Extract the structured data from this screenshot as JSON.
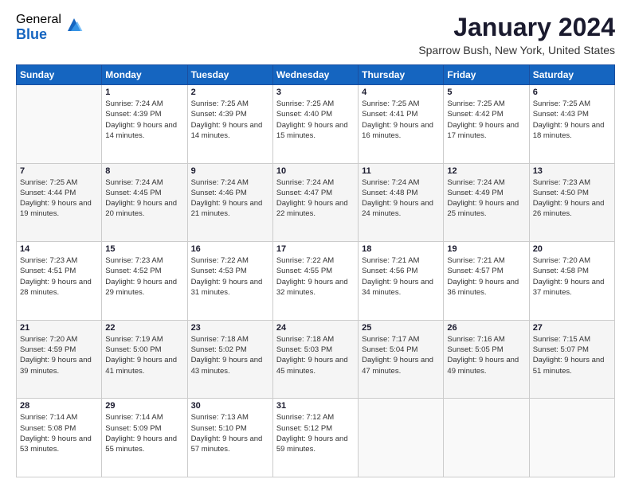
{
  "logo": {
    "general": "General",
    "blue": "Blue"
  },
  "title": "January 2024",
  "location": "Sparrow Bush, New York, United States",
  "days_of_week": [
    "Sunday",
    "Monday",
    "Tuesday",
    "Wednesday",
    "Thursday",
    "Friday",
    "Saturday"
  ],
  "weeks": [
    [
      {
        "day": "",
        "sunrise": "",
        "sunset": "",
        "daylight": ""
      },
      {
        "day": "1",
        "sunrise": "Sunrise: 7:24 AM",
        "sunset": "Sunset: 4:39 PM",
        "daylight": "Daylight: 9 hours and 14 minutes."
      },
      {
        "day": "2",
        "sunrise": "Sunrise: 7:25 AM",
        "sunset": "Sunset: 4:39 PM",
        "daylight": "Daylight: 9 hours and 14 minutes."
      },
      {
        "day": "3",
        "sunrise": "Sunrise: 7:25 AM",
        "sunset": "Sunset: 4:40 PM",
        "daylight": "Daylight: 9 hours and 15 minutes."
      },
      {
        "day": "4",
        "sunrise": "Sunrise: 7:25 AM",
        "sunset": "Sunset: 4:41 PM",
        "daylight": "Daylight: 9 hours and 16 minutes."
      },
      {
        "day": "5",
        "sunrise": "Sunrise: 7:25 AM",
        "sunset": "Sunset: 4:42 PM",
        "daylight": "Daylight: 9 hours and 17 minutes."
      },
      {
        "day": "6",
        "sunrise": "Sunrise: 7:25 AM",
        "sunset": "Sunset: 4:43 PM",
        "daylight": "Daylight: 9 hours and 18 minutes."
      }
    ],
    [
      {
        "day": "7",
        "sunrise": "Sunrise: 7:25 AM",
        "sunset": "Sunset: 4:44 PM",
        "daylight": "Daylight: 9 hours and 19 minutes."
      },
      {
        "day": "8",
        "sunrise": "Sunrise: 7:24 AM",
        "sunset": "Sunset: 4:45 PM",
        "daylight": "Daylight: 9 hours and 20 minutes."
      },
      {
        "day": "9",
        "sunrise": "Sunrise: 7:24 AM",
        "sunset": "Sunset: 4:46 PM",
        "daylight": "Daylight: 9 hours and 21 minutes."
      },
      {
        "day": "10",
        "sunrise": "Sunrise: 7:24 AM",
        "sunset": "Sunset: 4:47 PM",
        "daylight": "Daylight: 9 hours and 22 minutes."
      },
      {
        "day": "11",
        "sunrise": "Sunrise: 7:24 AM",
        "sunset": "Sunset: 4:48 PM",
        "daylight": "Daylight: 9 hours and 24 minutes."
      },
      {
        "day": "12",
        "sunrise": "Sunrise: 7:24 AM",
        "sunset": "Sunset: 4:49 PM",
        "daylight": "Daylight: 9 hours and 25 minutes."
      },
      {
        "day": "13",
        "sunrise": "Sunrise: 7:23 AM",
        "sunset": "Sunset: 4:50 PM",
        "daylight": "Daylight: 9 hours and 26 minutes."
      }
    ],
    [
      {
        "day": "14",
        "sunrise": "Sunrise: 7:23 AM",
        "sunset": "Sunset: 4:51 PM",
        "daylight": "Daylight: 9 hours and 28 minutes."
      },
      {
        "day": "15",
        "sunrise": "Sunrise: 7:23 AM",
        "sunset": "Sunset: 4:52 PM",
        "daylight": "Daylight: 9 hours and 29 minutes."
      },
      {
        "day": "16",
        "sunrise": "Sunrise: 7:22 AM",
        "sunset": "Sunset: 4:53 PM",
        "daylight": "Daylight: 9 hours and 31 minutes."
      },
      {
        "day": "17",
        "sunrise": "Sunrise: 7:22 AM",
        "sunset": "Sunset: 4:55 PM",
        "daylight": "Daylight: 9 hours and 32 minutes."
      },
      {
        "day": "18",
        "sunrise": "Sunrise: 7:21 AM",
        "sunset": "Sunset: 4:56 PM",
        "daylight": "Daylight: 9 hours and 34 minutes."
      },
      {
        "day": "19",
        "sunrise": "Sunrise: 7:21 AM",
        "sunset": "Sunset: 4:57 PM",
        "daylight": "Daylight: 9 hours and 36 minutes."
      },
      {
        "day": "20",
        "sunrise": "Sunrise: 7:20 AM",
        "sunset": "Sunset: 4:58 PM",
        "daylight": "Daylight: 9 hours and 37 minutes."
      }
    ],
    [
      {
        "day": "21",
        "sunrise": "Sunrise: 7:20 AM",
        "sunset": "Sunset: 4:59 PM",
        "daylight": "Daylight: 9 hours and 39 minutes."
      },
      {
        "day": "22",
        "sunrise": "Sunrise: 7:19 AM",
        "sunset": "Sunset: 5:00 PM",
        "daylight": "Daylight: 9 hours and 41 minutes."
      },
      {
        "day": "23",
        "sunrise": "Sunrise: 7:18 AM",
        "sunset": "Sunset: 5:02 PM",
        "daylight": "Daylight: 9 hours and 43 minutes."
      },
      {
        "day": "24",
        "sunrise": "Sunrise: 7:18 AM",
        "sunset": "Sunset: 5:03 PM",
        "daylight": "Daylight: 9 hours and 45 minutes."
      },
      {
        "day": "25",
        "sunrise": "Sunrise: 7:17 AM",
        "sunset": "Sunset: 5:04 PM",
        "daylight": "Daylight: 9 hours and 47 minutes."
      },
      {
        "day": "26",
        "sunrise": "Sunrise: 7:16 AM",
        "sunset": "Sunset: 5:05 PM",
        "daylight": "Daylight: 9 hours and 49 minutes."
      },
      {
        "day": "27",
        "sunrise": "Sunrise: 7:15 AM",
        "sunset": "Sunset: 5:07 PM",
        "daylight": "Daylight: 9 hours and 51 minutes."
      }
    ],
    [
      {
        "day": "28",
        "sunrise": "Sunrise: 7:14 AM",
        "sunset": "Sunset: 5:08 PM",
        "daylight": "Daylight: 9 hours and 53 minutes."
      },
      {
        "day": "29",
        "sunrise": "Sunrise: 7:14 AM",
        "sunset": "Sunset: 5:09 PM",
        "daylight": "Daylight: 9 hours and 55 minutes."
      },
      {
        "day": "30",
        "sunrise": "Sunrise: 7:13 AM",
        "sunset": "Sunset: 5:10 PM",
        "daylight": "Daylight: 9 hours and 57 minutes."
      },
      {
        "day": "31",
        "sunrise": "Sunrise: 7:12 AM",
        "sunset": "Sunset: 5:12 PM",
        "daylight": "Daylight: 9 hours and 59 minutes."
      },
      {
        "day": "",
        "sunrise": "",
        "sunset": "",
        "daylight": ""
      },
      {
        "day": "",
        "sunrise": "",
        "sunset": "",
        "daylight": ""
      },
      {
        "day": "",
        "sunrise": "",
        "sunset": "",
        "daylight": ""
      }
    ]
  ]
}
